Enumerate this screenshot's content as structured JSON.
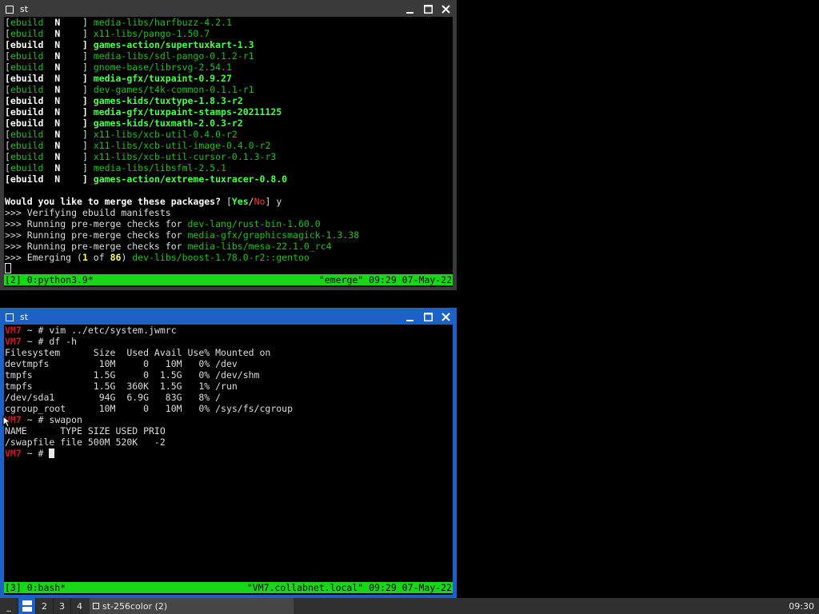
{
  "window1": {
    "title": "st",
    "lines": [
      {
        "seg": [
          [
            "w",
            "["
          ],
          [
            "g",
            "ebuild"
          ],
          [
            "b",
            "  N    "
          ],
          [
            "w",
            "] "
          ],
          [
            "g",
            "media-libs/harfbuzz-4.2.1"
          ]
        ]
      },
      {
        "seg": [
          [
            "w",
            "["
          ],
          [
            "g",
            "ebuild"
          ],
          [
            "b",
            "  N    "
          ],
          [
            "w",
            "] "
          ],
          [
            "g",
            "x11-libs/pango-1.50.7"
          ]
        ]
      },
      {
        "seg": [
          [
            "b",
            "[ebuild  N    ] "
          ],
          [
            "bg",
            "games-action/supertuxkart-1.3"
          ]
        ]
      },
      {
        "seg": [
          [
            "w",
            "["
          ],
          [
            "g",
            "ebuild"
          ],
          [
            "b",
            "  N    "
          ],
          [
            "w",
            "] "
          ],
          [
            "g",
            "media-libs/sdl-pango-0.1.2-r1"
          ]
        ]
      },
      {
        "seg": [
          [
            "w",
            "["
          ],
          [
            "g",
            "ebuild"
          ],
          [
            "b",
            "  N    "
          ],
          [
            "w",
            "] "
          ],
          [
            "g",
            "gnome-base/librsvg-2.54.1"
          ]
        ]
      },
      {
        "seg": [
          [
            "b",
            "[ebuild  N    ] "
          ],
          [
            "bg",
            "media-gfx/tuxpaint-0.9.27"
          ]
        ]
      },
      {
        "seg": [
          [
            "w",
            "["
          ],
          [
            "g",
            "ebuild"
          ],
          [
            "b",
            "  N    "
          ],
          [
            "w",
            "] "
          ],
          [
            "g",
            "dev-games/t4k-common-0.1.1-r1"
          ]
        ]
      },
      {
        "seg": [
          [
            "b",
            "[ebuild  N    ] "
          ],
          [
            "bg",
            "games-kids/tuxtype-1.8.3-r2"
          ]
        ]
      },
      {
        "seg": [
          [
            "b",
            "[ebuild  N    ] "
          ],
          [
            "bg",
            "media-gfx/tuxpaint-stamps-20211125"
          ]
        ]
      },
      {
        "seg": [
          [
            "b",
            "[ebuild  N    ] "
          ],
          [
            "bg",
            "games-kids/tuxmath-2.0.3-r2"
          ]
        ]
      },
      {
        "seg": [
          [
            "w",
            "["
          ],
          [
            "g",
            "ebuild"
          ],
          [
            "b",
            "  N    "
          ],
          [
            "w",
            "] "
          ],
          [
            "g",
            "x11-libs/xcb-util-0.4.0-r2"
          ]
        ]
      },
      {
        "seg": [
          [
            "w",
            "["
          ],
          [
            "g",
            "ebuild"
          ],
          [
            "b",
            "  N    "
          ],
          [
            "w",
            "] "
          ],
          [
            "g",
            "x11-libs/xcb-util-image-0.4.0-r2"
          ]
        ]
      },
      {
        "seg": [
          [
            "w",
            "["
          ],
          [
            "g",
            "ebuild"
          ],
          [
            "b",
            "  N    "
          ],
          [
            "w",
            "] "
          ],
          [
            "g",
            "x11-libs/xcb-util-cursor-0.1.3-r3"
          ]
        ]
      },
      {
        "seg": [
          [
            "w",
            "["
          ],
          [
            "g",
            "ebuild"
          ],
          [
            "b",
            "  N    "
          ],
          [
            "w",
            "] "
          ],
          [
            "g",
            "media-libs/libsfml-2.5.1"
          ]
        ]
      },
      {
        "seg": [
          [
            "b",
            "[ebuild  N    ] "
          ],
          [
            "bg",
            "games-action/extreme-tuxracer-0.8.0"
          ]
        ]
      },
      {
        "seg": [
          [
            "w",
            ""
          ]
        ]
      },
      {
        "seg": [
          [
            "b",
            "Would you like to merge these packages? "
          ],
          [
            "w",
            "["
          ],
          [
            "bg",
            "Yes"
          ],
          [
            "w",
            "/"
          ],
          [
            "r",
            "No"
          ],
          [
            "w",
            "] y"
          ]
        ]
      },
      {
        "seg": [
          [
            "w",
            ">>> Verifying ebuild manifests"
          ]
        ]
      },
      {
        "seg": [
          [
            "w",
            ">>> Running pre-merge checks for "
          ],
          [
            "g",
            "dev-lang/rust-bin-1.60.0"
          ]
        ]
      },
      {
        "seg": [
          [
            "w",
            ">>> Running pre-merge checks for "
          ],
          [
            "g",
            "media-gfx/graphicsmagick-1.3.38"
          ]
        ]
      },
      {
        "seg": [
          [
            "w",
            ">>> Running pre-merge checks for "
          ],
          [
            "g",
            "media-libs/mesa-22.1.0_rc4"
          ]
        ]
      },
      {
        "seg": [
          [
            "w",
            ">>> Emerging ("
          ],
          [
            "yb",
            "1"
          ],
          [
            "w",
            " of "
          ],
          [
            "yb",
            "86"
          ],
          [
            "w",
            ") "
          ],
          [
            "g",
            "dev-libs/boost-1.78.0-r2::gentoo"
          ]
        ]
      }
    ],
    "status_left": "[2] 0:python3.9*",
    "status_right": "\"emerge\" 09:29 07-May-22"
  },
  "window2": {
    "title": "st",
    "lines": [
      {
        "seg": [
          [
            "rb",
            "VM7"
          ],
          [
            "w",
            " ~ # vim ../etc/system.jwmrc"
          ]
        ]
      },
      {
        "seg": [
          [
            "rb",
            "VM7"
          ],
          [
            "w",
            " ~ # df -h"
          ]
        ]
      },
      {
        "seg": [
          [
            "w",
            "Filesystem      Size  Used Avail Use% Mounted on"
          ]
        ]
      },
      {
        "seg": [
          [
            "w",
            "devtmpfs         10M     0   10M   0% /dev"
          ]
        ]
      },
      {
        "seg": [
          [
            "w",
            "tmpfs           1.5G     0  1.5G   0% /dev/shm"
          ]
        ]
      },
      {
        "seg": [
          [
            "w",
            "tmpfs           1.5G  360K  1.5G   1% /run"
          ]
        ]
      },
      {
        "seg": [
          [
            "w",
            "/dev/sda1        94G  6.9G   83G   8% /"
          ]
        ]
      },
      {
        "seg": [
          [
            "w",
            "cgroup_root      10M     0   10M   0% /sys/fs/cgroup"
          ]
        ]
      },
      {
        "seg": [
          [
            "rb",
            "VM7"
          ],
          [
            "w",
            " ~ # swapon"
          ]
        ]
      },
      {
        "seg": [
          [
            "w",
            "NAME      TYPE SIZE USED PRIO"
          ]
        ]
      },
      {
        "seg": [
          [
            "w",
            "/swapfile file 500M 520K   -2"
          ]
        ]
      },
      {
        "seg": [
          [
            "rb",
            "VM7"
          ],
          [
            "w",
            " ~ # "
          ]
        ]
      }
    ],
    "status_left": "[3] 0:bash*",
    "status_right": "\"VM7.collabnet.local\" 09:29 07-May-22"
  },
  "taskbar": {
    "menu": "_",
    "desktops": [
      "2",
      "3",
      "4"
    ],
    "task_label": "st-256color (2)",
    "clock": "09:30"
  }
}
